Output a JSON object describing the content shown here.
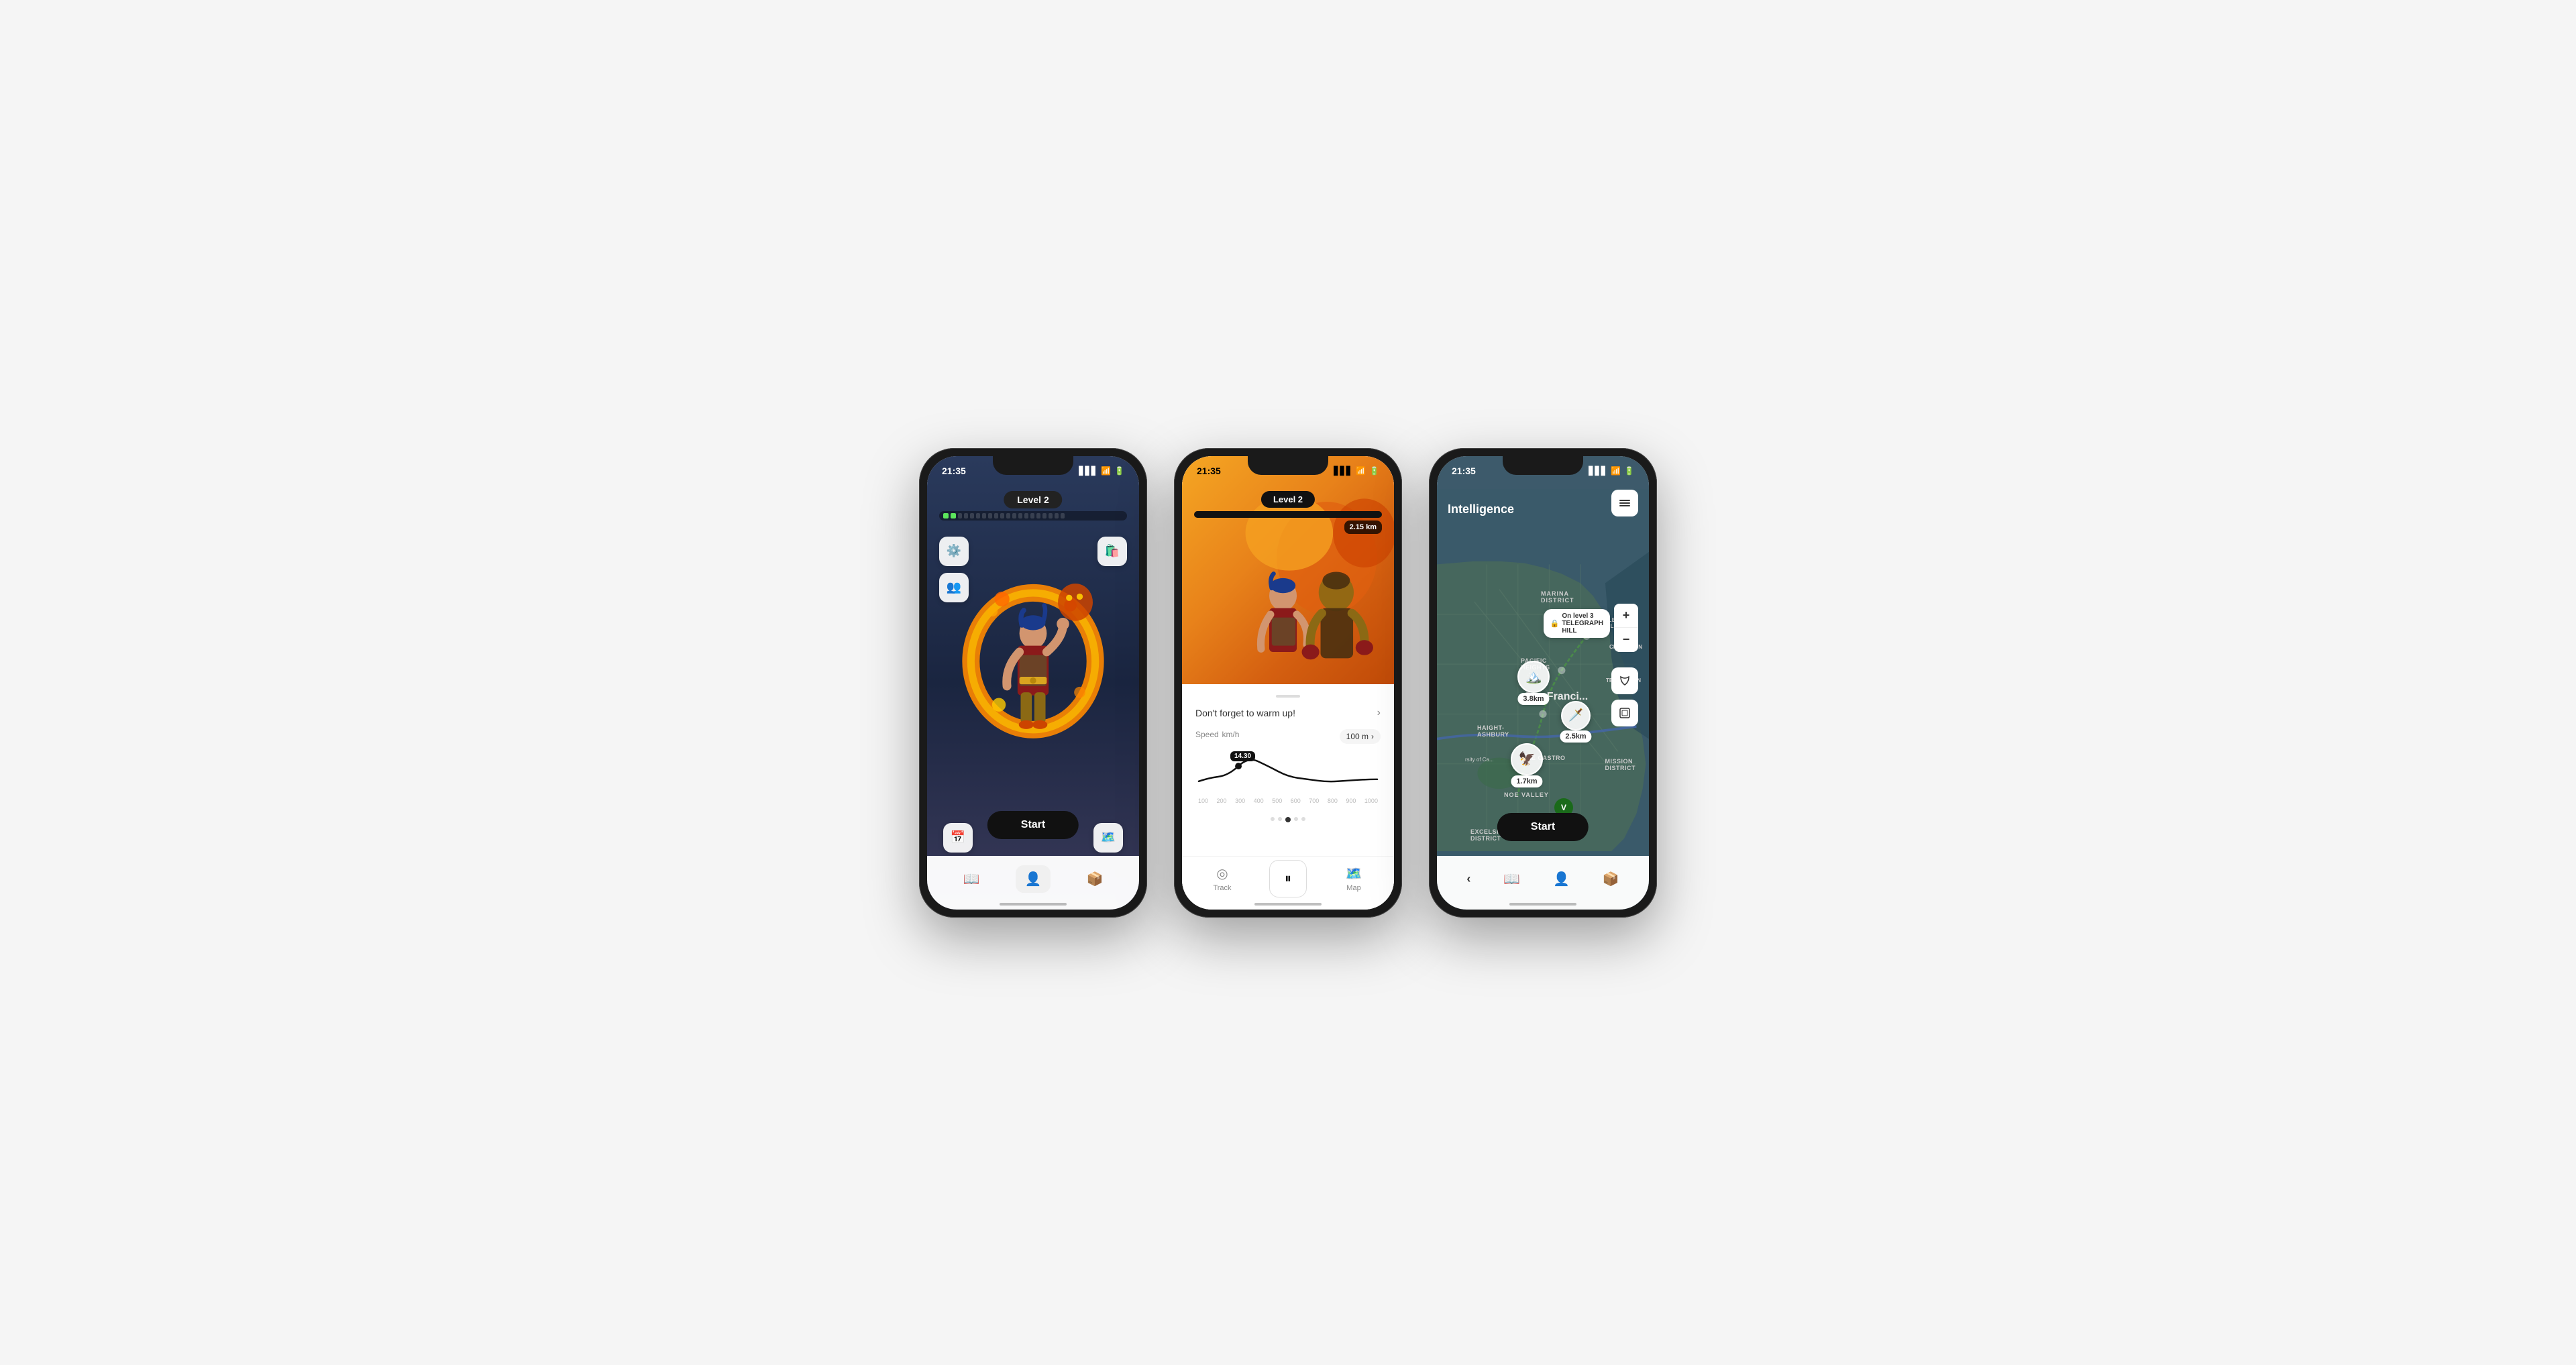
{
  "phone1": {
    "status_time": "21:35",
    "level": "Level 2",
    "start_label": "Start",
    "tabs": [
      {
        "label": "book",
        "icon": "📖",
        "active": false
      },
      {
        "label": "profile",
        "icon": "👤",
        "active": true
      },
      {
        "label": "box",
        "icon": "📦",
        "active": false
      }
    ],
    "side_left": [
      {
        "icon": "⚙️",
        "name": "settings-icon"
      },
      {
        "icon": "👥",
        "name": "add-friend-icon"
      }
    ],
    "side_right": [
      {
        "icon": "🛍️",
        "name": "shop-icon"
      }
    ],
    "bottom_left": {
      "icon": "📅",
      "name": "calendar-icon"
    },
    "bottom_right": {
      "icon": "🗺️",
      "name": "map-icon"
    }
  },
  "phone2": {
    "status_time": "21:35",
    "level": "Level 2",
    "distance": "2.15 km",
    "warmup_text": "Don't forget to warm up!",
    "speed_label": "Speed",
    "speed_unit": "km/h",
    "speed_range": "100 m",
    "speed_value": "14.30",
    "chart_labels": [
      "100",
      "200",
      "300",
      "400",
      "500",
      "600",
      "700",
      "800",
      "900",
      "1000"
    ],
    "nav": [
      {
        "label": "Track",
        "icon": "◎"
      },
      {
        "label": "pause",
        "icon": "⏸"
      },
      {
        "label": "Map",
        "icon": "🗺️"
      }
    ]
  },
  "phone3": {
    "status_time": "21:35",
    "title": "Intelligence",
    "start_label": "Start",
    "map_tooltip": "On level 3 TELEGRAPH HILL",
    "markers": [
      {
        "label": "3.8km",
        "area": "PACIFIC HEIGHTS"
      },
      {
        "label": "2.5km",
        "area": "San Francisco"
      },
      {
        "label": "1.7km",
        "area": "Castro"
      }
    ],
    "districts": [
      "MARINA DISTRICT",
      "TELEGRAPH HILL",
      "CHINATOWN",
      "PACIFIC HEIGHTS",
      "TENDERLOIN",
      "HAIGHT-ASHBURY",
      "NOE VALLEY",
      "MISSION DISTRICT",
      "EXCELSIOR DISTRICT"
    ],
    "nav": [
      "‹",
      "📖",
      "👤",
      "📦"
    ],
    "zoom_plus": "+",
    "zoom_minus": "−"
  }
}
